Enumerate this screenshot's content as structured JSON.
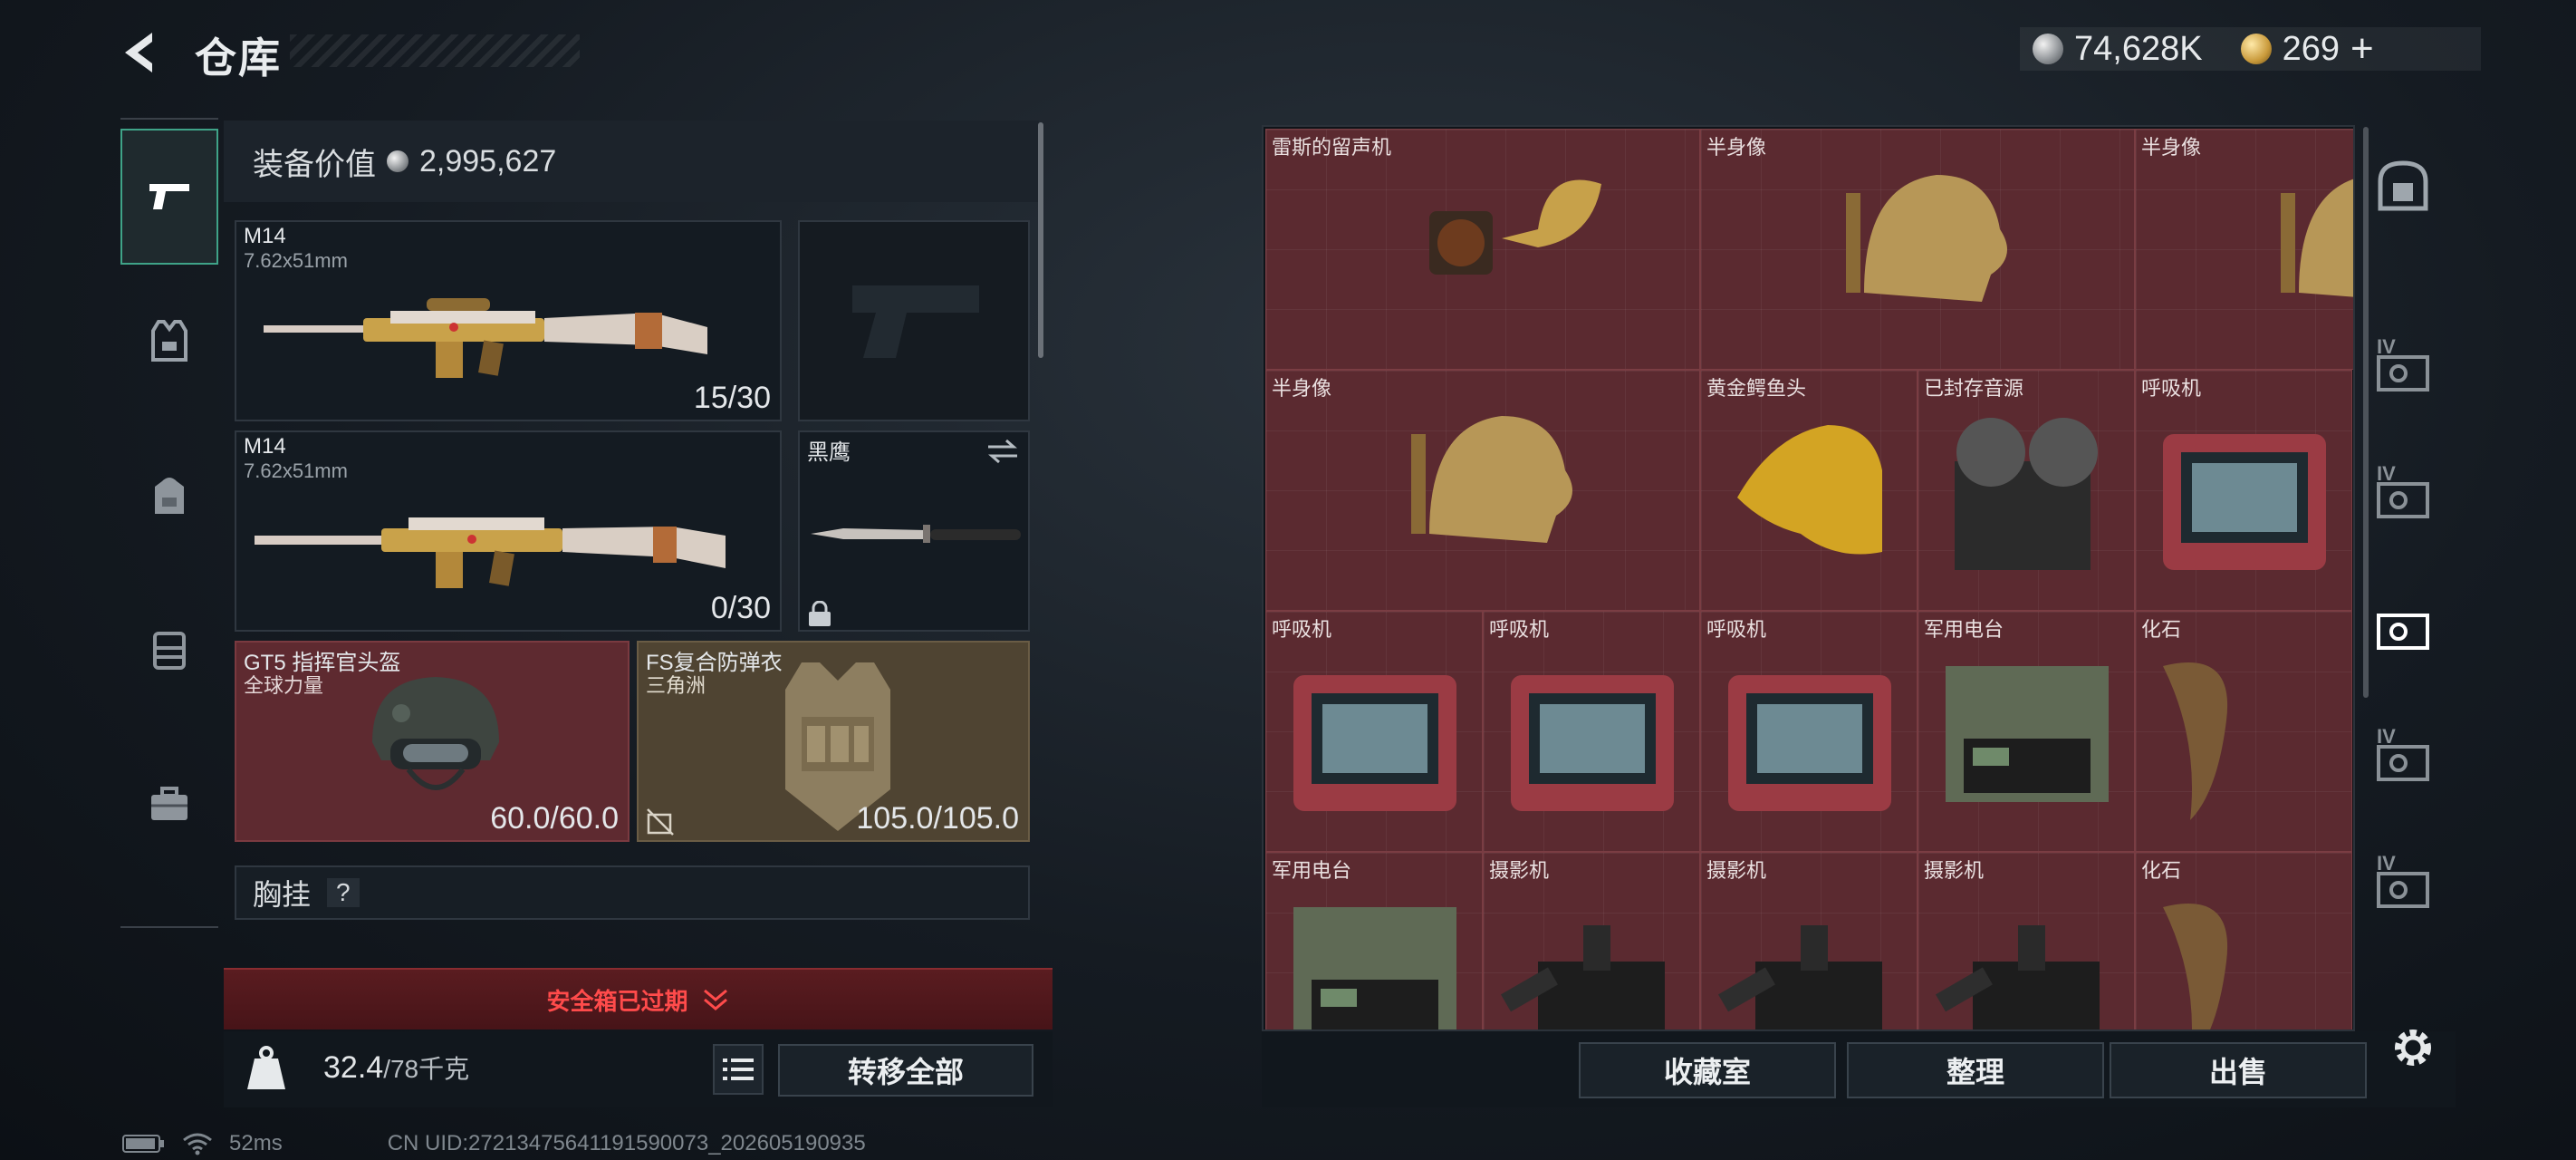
{
  "header": {
    "title": "仓库"
  },
  "currency": {
    "silver": "74,628K",
    "gold": "269",
    "add_symbol": "+"
  },
  "equipment": {
    "value_label": "装备价值",
    "value": "2,995,627",
    "slots": {
      "weapon1": {
        "name": "M14",
        "caliber": "7.62x51mm",
        "ammo": "15/30"
      },
      "weapon2": {
        "name": "M14",
        "caliber": "7.62x51mm",
        "ammo": "0/30"
      },
      "melee": {
        "name": "黑鹰"
      },
      "helmet": {
        "name": "GT5 指挥官头盔",
        "sub": "全球力量",
        "durability": "60.0/60.0"
      },
      "armor": {
        "name": "FS复合防弹衣",
        "sub": "三角洲",
        "durability": "105.0/105.0"
      },
      "chest_rig": {
        "label": "胸挂",
        "help": "?"
      }
    }
  },
  "safebox": {
    "label": "安全箱已过期"
  },
  "inventory": {
    "weight_current": "32.4",
    "weight_max": "/78千克",
    "transfer_label": "转移全部"
  },
  "status": {
    "ping": "52ms",
    "uid": "CN UID:27213475641191590073_202605190935"
  },
  "stash": {
    "items": [
      {
        "label": "雷斯的留声机",
        "icon": "gramophone-icon"
      },
      {
        "label": "半身像",
        "icon": "bust-icon"
      },
      {
        "label": "半身像",
        "icon": "bust-icon"
      },
      {
        "label": "半身像",
        "icon": "bust-icon"
      },
      {
        "label": "黄金鳄鱼头",
        "icon": "golden-crocodile-head-icon"
      },
      {
        "label": "已封存音源",
        "icon": "reel-recorder-icon"
      },
      {
        "label": "呼吸机",
        "icon": "ventilator-icon"
      },
      {
        "label": "呼吸机",
        "icon": "ventilator-icon"
      },
      {
        "label": "呼吸机",
        "icon": "ventilator-icon"
      },
      {
        "label": "呼吸机",
        "icon": "ventilator-icon"
      },
      {
        "label": "军用电台",
        "icon": "military-radio-icon"
      },
      {
        "label": "化石",
        "icon": "fossil-claw-icon"
      },
      {
        "label": "军用电台",
        "icon": "military-radio-icon"
      },
      {
        "label": "摄影机",
        "icon": "film-camera-icon"
      },
      {
        "label": "摄影机",
        "icon": "film-camera-icon"
      },
      {
        "label": "摄影机",
        "icon": "film-camera-icon"
      },
      {
        "label": "化石",
        "icon": "fossil-claw-icon"
      }
    ],
    "buttons": {
      "collection": "收藏室",
      "sort": "整理",
      "sell": "出售"
    }
  },
  "tab_badges": {
    "level": "IV"
  }
}
